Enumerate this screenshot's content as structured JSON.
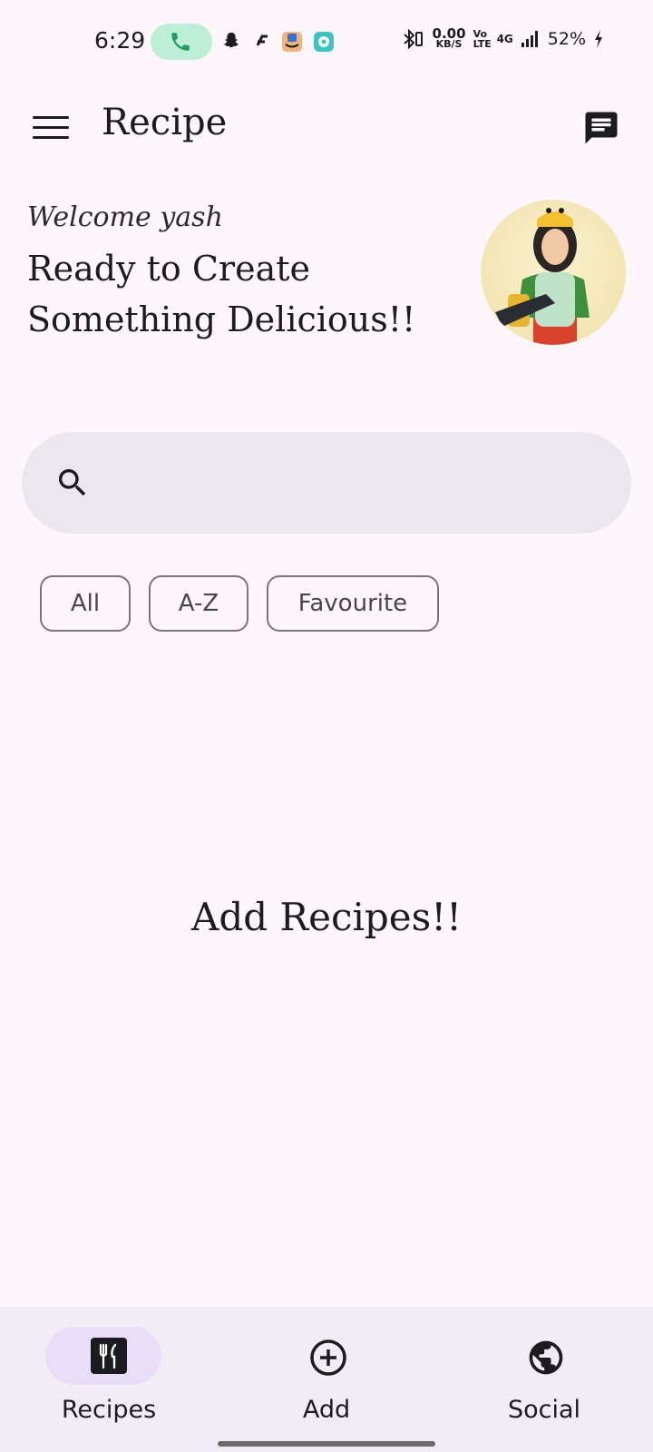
{
  "status_bar": {
    "time": "6:29",
    "speed_value": "0.00",
    "speed_unit": "KB/S",
    "volte": "Vo LTE",
    "network": "4G",
    "battery": "52%"
  },
  "app_bar": {
    "title": "Recipe"
  },
  "greeting": {
    "welcome": "Welcome yash",
    "headline": "Ready to Create Something Delicious!!"
  },
  "search": {
    "placeholder": ""
  },
  "filters": {
    "chips": [
      "All",
      "A-Z",
      "Favourite"
    ]
  },
  "empty_state": {
    "message": "Add Recipes!!"
  },
  "bottom_nav": {
    "items": [
      {
        "label": "Recipes",
        "icon": "restaurant-icon",
        "selected": true
      },
      {
        "label": "Add",
        "icon": "add-circle-icon",
        "selected": false
      },
      {
        "label": "Social",
        "icon": "globe-icon",
        "selected": false
      }
    ]
  },
  "colors": {
    "background": "#fdf7fc",
    "search_fill": "#ebe7ee",
    "nav_background": "#f2ecf4",
    "nav_indicator": "#e8def8",
    "call_pill": "#bfeed6"
  }
}
